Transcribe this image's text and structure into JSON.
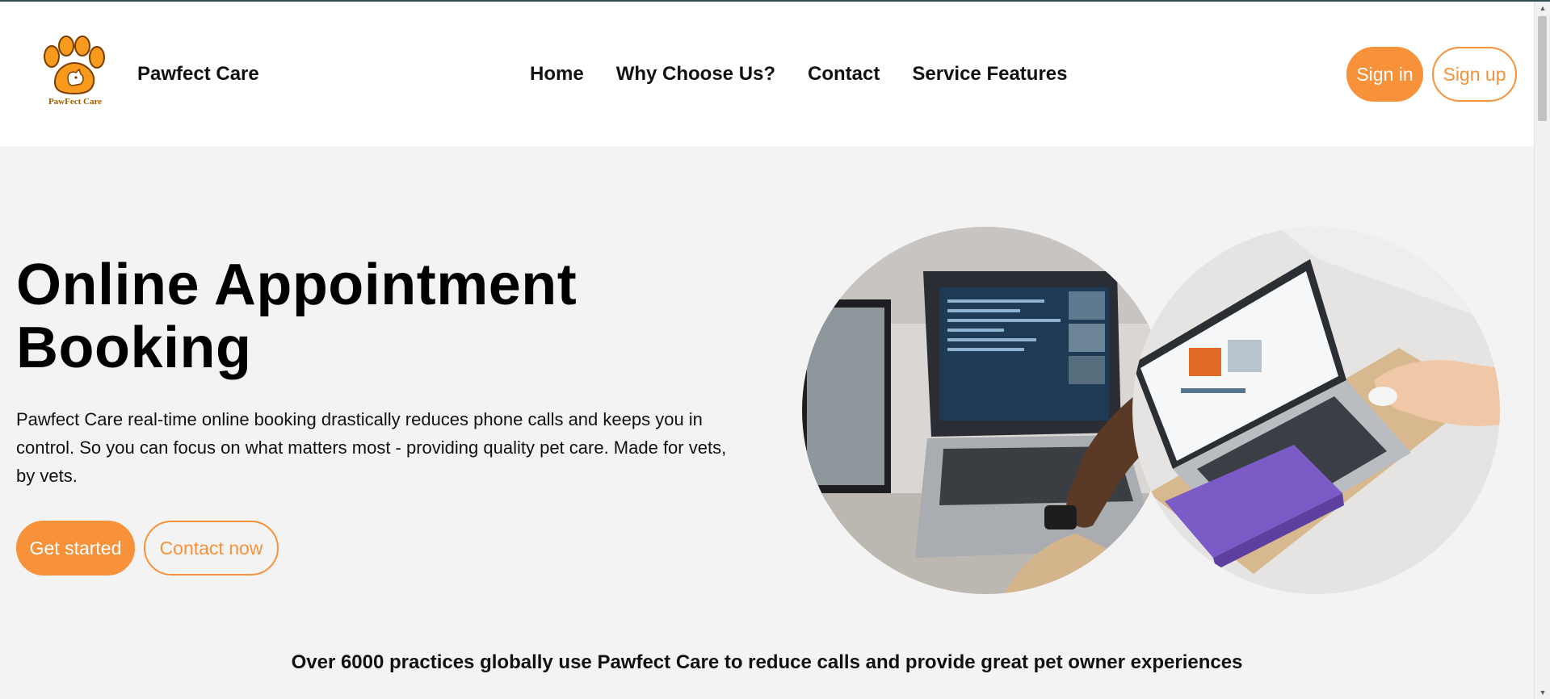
{
  "brand": {
    "logo_text": "PawFect Care",
    "name": "Pawfect Care"
  },
  "nav": {
    "items": [
      "Home",
      "Why Choose Us?",
      "Contact",
      "Service Features"
    ]
  },
  "auth": {
    "sign_in": "Sign in",
    "sign_up": "Sign up"
  },
  "hero": {
    "title_line1": "Online Appointment",
    "title_line2": "Booking",
    "description": "Pawfect Care real-time online booking drastically reduces phone calls and keeps you in control. So you can focus on what matters most - providing quality pet care. Made for vets, by vets.",
    "primary_button": "Get started",
    "secondary_button": "Contact now"
  },
  "tagline": "Over 6000 practices globally use Pawfect Care to reduce calls and provide great pet owner experiences",
  "colors": {
    "accent": "#f7923a",
    "background": "#f3f3f3",
    "header_bg": "#ffffff"
  },
  "icons": {
    "logo": "paw-logo-icon",
    "scroll_up": "scroll-up-icon",
    "scroll_down": "scroll-down-icon"
  }
}
